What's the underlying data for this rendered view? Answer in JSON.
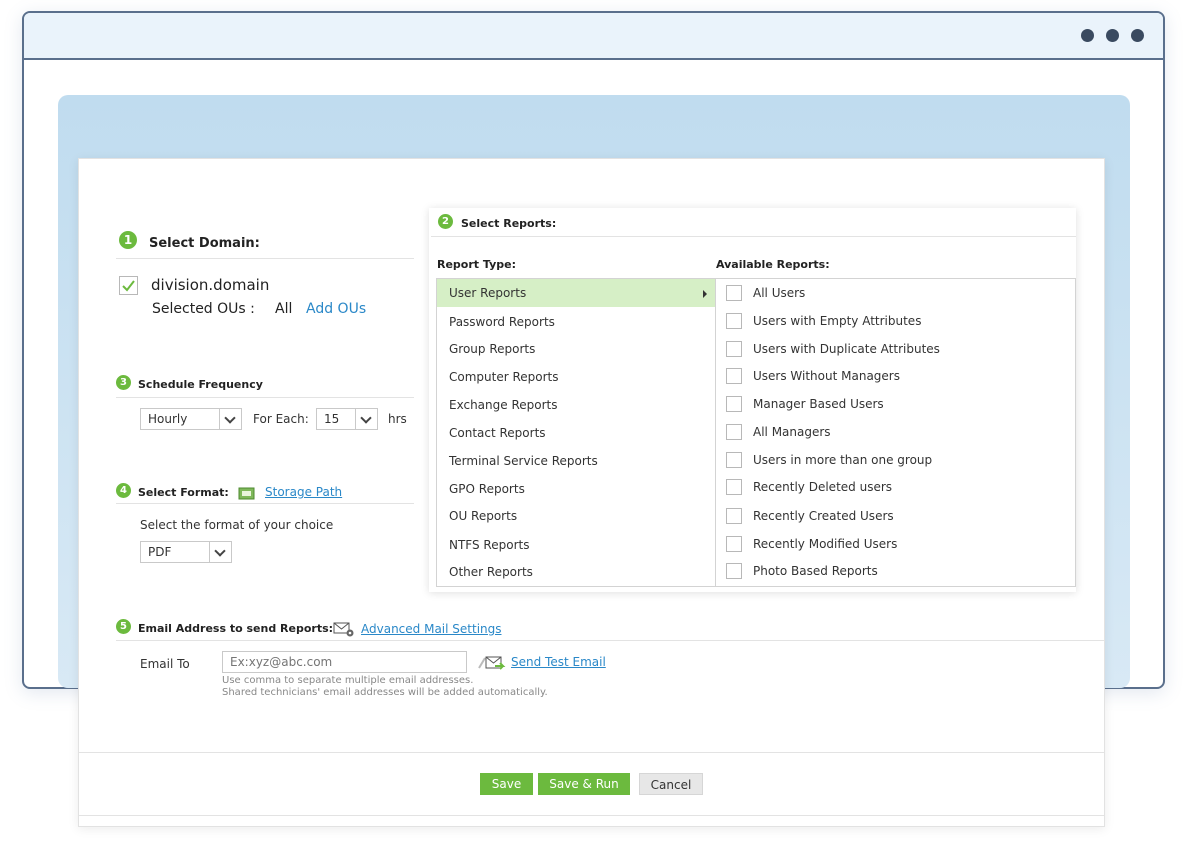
{
  "domain_section": {
    "step": "1",
    "title": "Select Domain:",
    "domain_name": "division.domain",
    "ous_label": "Selected OUs :",
    "ous_value": "All",
    "add_ous": "Add OUs"
  },
  "reports_section": {
    "step": "2",
    "title": "Select Reports:",
    "report_type_header": "Report Type:",
    "available_header": "Available Reports:",
    "report_types": [
      "User Reports",
      "Password Reports",
      "Group Reports",
      "Computer Reports",
      "Exchange Reports",
      "Contact Reports",
      "Terminal Service Reports",
      "GPO Reports",
      "OU Reports",
      "NTFS Reports",
      "Other Reports"
    ],
    "selected_report_type": "User Reports",
    "available_reports": [
      "All Users",
      "Users with Empty Attributes",
      "Users with Duplicate Attributes",
      "Users Without Managers",
      "Manager Based Users",
      "All Managers",
      "Users in more than one group",
      "Recently Deleted users",
      "Recently Created Users",
      "Recently Modified Users",
      "Photo Based Reports"
    ]
  },
  "schedule_section": {
    "step": "3",
    "title": "Schedule Frequency",
    "frequency": "Hourly",
    "for_each_label": "For Each:",
    "interval": "15",
    "unit": "hrs"
  },
  "format_section": {
    "step": "4",
    "title": "Select Format:",
    "storage_path": "Storage Path",
    "prompt": "Select the format of your choice",
    "format": "PDF"
  },
  "email_section": {
    "step": "5",
    "title": "Email Address to send Reports:",
    "advanced_mail": "Advanced Mail Settings",
    "email_to_label": "Email To",
    "email_placeholder": "Ex:xyz@abc.com",
    "send_test": "Send Test Email",
    "hint_1": "Use comma to separate multiple email addresses.",
    "hint_2": "Shared technicians' email addresses will be added automatically."
  },
  "buttons": {
    "save": "Save",
    "save_run": "Save & Run",
    "cancel": "Cancel"
  },
  "colors": {
    "accent_green": "#6cba3e",
    "link_blue": "#2a88c8",
    "selected_row": "#d6efc6"
  }
}
